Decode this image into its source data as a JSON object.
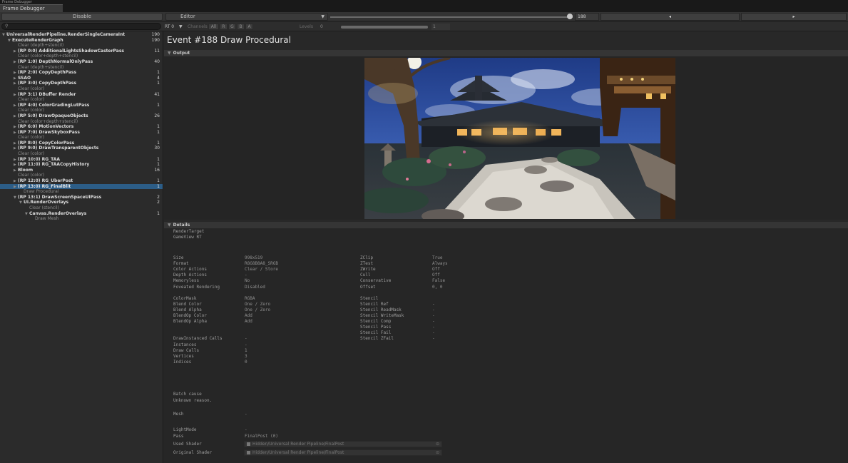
{
  "window": {
    "title": "Frame Debugger"
  },
  "tab": {
    "label": "Frame Debugger"
  },
  "toolbar": {
    "disable_label": "Disable",
    "target_label": "Editor",
    "event_index": "188",
    "prev_symbol": "◂",
    "next_symbol": "▸"
  },
  "toolbar2": {
    "search_placeholder": "",
    "search_icon": "search-icon",
    "rt_label": "RT 0",
    "channels_label": "Channels",
    "channels": [
      "All",
      "R",
      "G",
      "B",
      "A"
    ],
    "levels_label": "Levels",
    "levels_min": "0",
    "levels_max": "1",
    "levels_fill": 1.0
  },
  "tree": [
    {
      "label": "UniversalRenderPipeline.RenderSingleCameraInt",
      "count": "190",
      "indent": 0,
      "bold": true,
      "expanded": true
    },
    {
      "label": "ExecuteRenderGraph",
      "count": "190",
      "indent": 1,
      "bold": true,
      "expanded": true
    },
    {
      "label": "Clear (depth+stencil)",
      "count": "",
      "indent": 2,
      "sub": true
    },
    {
      "label": "(RP 0:0) AdditionalLightsShadowCasterPass",
      "count": "11",
      "indent": 2,
      "bold": true,
      "collapsed": true
    },
    {
      "label": "Clear (color+depth+stencil)",
      "count": "",
      "indent": 2,
      "sub": true
    },
    {
      "label": "(RP 1:0) DepthNormalOnlyPass",
      "count": "40",
      "indent": 2,
      "bold": true,
      "collapsed": true
    },
    {
      "label": "Clear (depth+stencil)",
      "count": "",
      "indent": 2,
      "sub": true
    },
    {
      "label": "(RP 2:0) CopyDepthPass",
      "count": "1",
      "indent": 2,
      "bold": true,
      "collapsed": true
    },
    {
      "label": "SSAO",
      "count": "4",
      "indent": 2,
      "bold": true,
      "collapsed": true
    },
    {
      "label": "(RP 3:0) CopyDepthPass",
      "count": "1",
      "indent": 2,
      "bold": true,
      "collapsed": true
    },
    {
      "label": "Clear (color)",
      "count": "",
      "indent": 2,
      "sub": true
    },
    {
      "label": "(RP 3:1) DBuffer Render",
      "count": "41",
      "indent": 2,
      "bold": true,
      "collapsed": true
    },
    {
      "label": "Clear (color)",
      "count": "",
      "indent": 2,
      "sub": true
    },
    {
      "label": "(RP 4:0) ColorGradingLutPass",
      "count": "1",
      "indent": 2,
      "bold": true,
      "collapsed": true
    },
    {
      "label": "Clear (color)",
      "count": "",
      "indent": 2,
      "sub": true
    },
    {
      "label": "(RP 5:0) DrawOpaqueObjects",
      "count": "26",
      "indent": 2,
      "bold": true,
      "collapsed": true
    },
    {
      "label": "Clear (color+depth+stencil)",
      "count": "",
      "indent": 2,
      "sub": true
    },
    {
      "label": "(RP 6:0) MotionVectors",
      "count": "1",
      "indent": 2,
      "bold": true,
      "collapsed": true
    },
    {
      "label": "(RP 7:0) DrawSkyboxPass",
      "count": "1",
      "indent": 2,
      "bold": true,
      "collapsed": true
    },
    {
      "label": "Clear (color)",
      "count": "",
      "indent": 2,
      "sub": true
    },
    {
      "label": "(RP 8:0) CopyColorPass",
      "count": "1",
      "indent": 2,
      "bold": true,
      "collapsed": true
    },
    {
      "label": "(RP 9:0) DrawTransparentObjects",
      "count": "30",
      "indent": 2,
      "bold": true,
      "collapsed": true
    },
    {
      "label": "Clear (color)",
      "count": "",
      "indent": 2,
      "sub": true
    },
    {
      "label": "(RP 10:0) RG_TAA",
      "count": "1",
      "indent": 2,
      "bold": true,
      "collapsed": true
    },
    {
      "label": "(RP 11:0) RG_TAACopyHistory",
      "count": "1",
      "indent": 2,
      "bold": true,
      "collapsed": true
    },
    {
      "label": "Bloom",
      "count": "16",
      "indent": 2,
      "bold": true,
      "collapsed": true
    },
    {
      "label": "Clear (color)",
      "count": "",
      "indent": 2,
      "sub": true
    },
    {
      "label": "(RP 12:0) RG_UberPost",
      "count": "1",
      "indent": 2,
      "bold": true,
      "collapsed": true
    },
    {
      "label": "(RP 13:0) RG_FinalBlit",
      "count": "1",
      "indent": 2,
      "bold": true,
      "collapsed": true,
      "selected": true
    },
    {
      "label": "Draw Procedural",
      "count": "",
      "indent": 3,
      "sub": true
    },
    {
      "label": "(RP 13:1) DrawScreenSpaceUIPass",
      "count": "2",
      "indent": 2,
      "bold": true,
      "expanded": true
    },
    {
      "label": "UI.RenderOverlays",
      "count": "2",
      "indent": 3,
      "bold": true,
      "expanded": true
    },
    {
      "label": "Clear (stencil)",
      "count": "",
      "indent": 4,
      "sub": true
    },
    {
      "label": "Canvas.RenderOverlays",
      "count": "1",
      "indent": 4,
      "bold": true,
      "expanded": true
    },
    {
      "label": "Draw Mesh",
      "count": "",
      "indent": 5,
      "sub": true
    }
  ],
  "main": {
    "event_title": "Event #188 Draw Procedural",
    "output_header": "Output",
    "details_header": "Details",
    "render_target_label": "RenderTarget",
    "render_target_value": "GameView RT",
    "left_rows": [
      [
        "Size",
        "998x519"
      ],
      [
        "Format",
        "R8G8B8A8_SRGB"
      ],
      [
        "Color Actions",
        "Clear / Store"
      ],
      [
        "Depth Actions",
        "-"
      ],
      [
        "Memoryless",
        "No"
      ],
      [
        "Foveated Rendering",
        "Disabled"
      ],
      [
        "",
        ""
      ],
      [
        "ColorMask",
        "RGBA"
      ],
      [
        "Blend Color",
        "One / Zero"
      ],
      [
        "Blend Alpha",
        "One / Zero"
      ],
      [
        "BlendOp Color",
        "Add"
      ],
      [
        "BlendOp Alpha",
        "Add"
      ],
      [
        "",
        ""
      ],
      [
        "",
        ""
      ],
      [
        "DrawInstanced Calls",
        "-"
      ],
      [
        "Instances",
        "-"
      ],
      [
        "Draw Calls",
        "1"
      ],
      [
        "Vertices",
        "3"
      ],
      [
        "Indices",
        "0"
      ]
    ],
    "right_rows": [
      [
        "ZClip",
        "True"
      ],
      [
        "ZTest",
        "Always"
      ],
      [
        "ZWrite",
        "Off"
      ],
      [
        "Cull",
        "Off"
      ],
      [
        "Conservative",
        "False"
      ],
      [
        "Offset",
        "0, 0"
      ],
      [
        "",
        ""
      ],
      [
        "Stencil",
        ""
      ],
      [
        "Stencil Ref",
        "-"
      ],
      [
        "Stencil ReadMask",
        "-"
      ],
      [
        "Stencil WriteMask",
        "-"
      ],
      [
        "Stencil Comp",
        "-"
      ],
      [
        "Stencil Pass",
        "-"
      ],
      [
        "Stencil Fail",
        "-"
      ],
      [
        "Stencil ZFail",
        "-"
      ]
    ],
    "batch_cause_label": "Batch cause",
    "batch_cause_value": "Unknown reason.",
    "mesh_label": "Mesh",
    "mesh_value": "-",
    "lightmode_label": "LightMode",
    "lightmode_value": "-",
    "pass_label": "Pass",
    "pass_value": "FinalPost (0)",
    "used_shader_label": "Used Shader",
    "used_shader_value": "Hidden/Universal Render Pipeline/FinalPost",
    "original_shader_label": "Original Shader",
    "original_shader_value": "Hidden/Universal Render Pipeline/FinalPost"
  }
}
